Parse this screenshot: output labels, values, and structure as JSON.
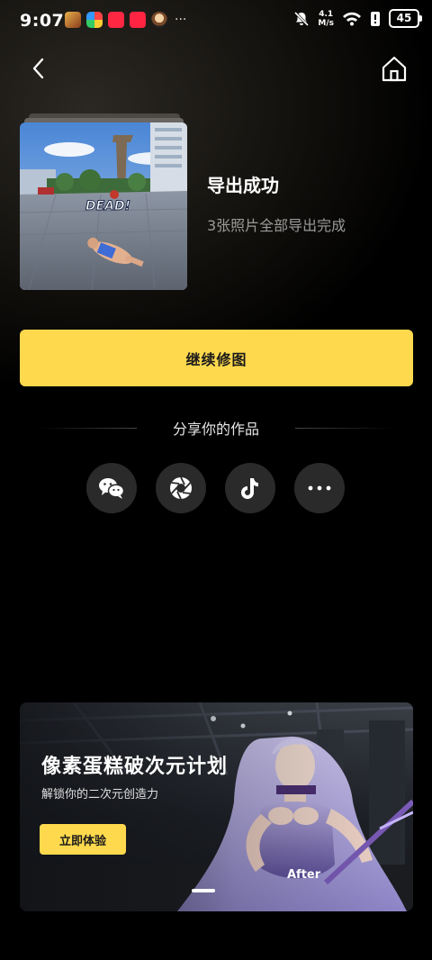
{
  "status_bar": {
    "time": "9:07",
    "net_speed_value": "4.1",
    "net_speed_unit": "M/s",
    "battery": "45",
    "overflow": "···"
  },
  "nav": {
    "back_icon": "chevron-left",
    "home_icon": "home"
  },
  "result": {
    "thumbnail_text": "DEAD!",
    "title": "导出成功",
    "subtitle": "3张照片全部导出完成"
  },
  "primary_button": {
    "label": "继续修图",
    "color": "#fed94d"
  },
  "share": {
    "title": "分享你的作品",
    "buttons": [
      {
        "icon": "wechat-icon"
      },
      {
        "icon": "aperture-icon"
      },
      {
        "icon": "tiktok-icon"
      },
      {
        "icon": "more-icon"
      }
    ]
  },
  "banner": {
    "title": "像素蛋糕破次元计划",
    "subtitle": "解锁你的二次元创造力",
    "button_label": "立即体验",
    "after_label": "After"
  }
}
